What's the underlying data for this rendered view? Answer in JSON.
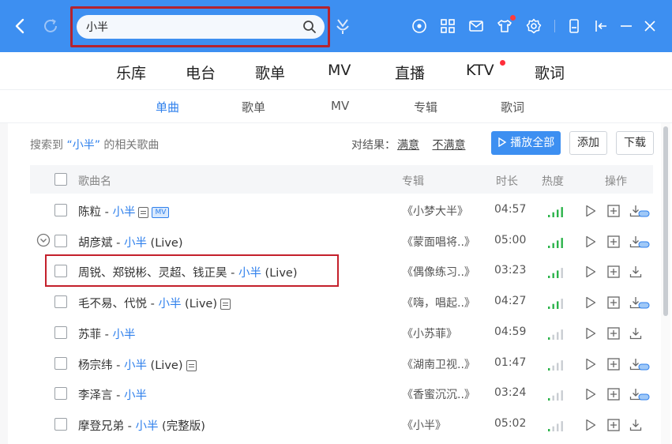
{
  "search": {
    "value": "小半"
  },
  "main_tabs": [
    "乐库",
    "电台",
    "歌单",
    "MV",
    "直播",
    "KTV",
    "歌词"
  ],
  "sub_tabs": [
    {
      "label": "单曲",
      "active": true
    },
    {
      "label": "歌单",
      "active": false
    },
    {
      "label": "MV",
      "active": false
    },
    {
      "label": "专辑",
      "active": false
    },
    {
      "label": "歌词",
      "active": false
    }
  ],
  "result": {
    "prefix": "搜索到",
    "keyword": "“小半”",
    "suffix": "的相关歌曲",
    "feedback_label": "对结果：",
    "satisfied": "满意",
    "unsatisfied": "不满意"
  },
  "buttons": {
    "play_all": "播放全部",
    "add": "添加",
    "download": "下载"
  },
  "table": {
    "headers": {
      "name": "歌曲名",
      "album": "专辑",
      "duration": "时长",
      "heat": "热度",
      "actions": "操作"
    },
    "rows": [
      {
        "artist": "陈粒",
        "sep": " - ",
        "song": "小半",
        "extra": "",
        "album": "《小梦大半》",
        "duration": "04:57",
        "heat_level": 4,
        "mv": "MV",
        "sq": true,
        "hq_download": true
      },
      {
        "artist": "胡彦斌",
        "sep": " - ",
        "song": "小半",
        "extra": " (Live)",
        "album": "《蒙面唱将..》",
        "duration": "05:00",
        "heat_level": 4,
        "mv": "",
        "sq": false,
        "hq_download": true
      },
      {
        "artist": "周锐、郑锐彬、灵超、钱正昊",
        "sep": " - ",
        "song": "小半",
        "extra": " (Live)",
        "album": "《偶像练习..》",
        "duration": "03:23",
        "heat_level": 3,
        "mv": "",
        "sq": false,
        "hq_download": false
      },
      {
        "artist": "毛不易、代悦",
        "sep": " - ",
        "song": "小半",
        "extra": " (Live)",
        "album": "《嗨，唱起..》",
        "duration": "04:27",
        "heat_level": 3,
        "mv": "",
        "sq": true,
        "hq_download": true
      },
      {
        "artist": "苏菲",
        "sep": " - ",
        "song": "小半",
        "extra": "",
        "album": "《小苏菲》",
        "duration": "04:59",
        "heat_level": 1,
        "mv": "",
        "sq": false,
        "hq_download": false
      },
      {
        "artist": "杨宗纬",
        "sep": " - ",
        "song": "小半",
        "extra": " (Live)",
        "album": "《湖南卫视..》",
        "duration": "01:47",
        "heat_level": 1,
        "mv": "",
        "sq": true,
        "hq_download": true
      },
      {
        "artist": "李泽言",
        "sep": " - ",
        "song": "小半",
        "extra": "",
        "album": "《香蜜沉沉..》",
        "duration": "03:24",
        "heat_level": 1,
        "mv": "",
        "sq": false,
        "hq_download": true
      },
      {
        "artist": "摩登兄弟",
        "sep": " - ",
        "song": "小半",
        "extra": " (完整版)",
        "album": "《小半》",
        "duration": "05:02",
        "heat_level": 1,
        "mv": "",
        "sq": false,
        "hq_download": false
      }
    ]
  },
  "colors": {
    "brand": "#3d8ff1",
    "accent_text": "#2f80ec",
    "heat_on": "#2bb34a",
    "heat_off": "#c9cdd2",
    "annotation": "#c4202b"
  }
}
